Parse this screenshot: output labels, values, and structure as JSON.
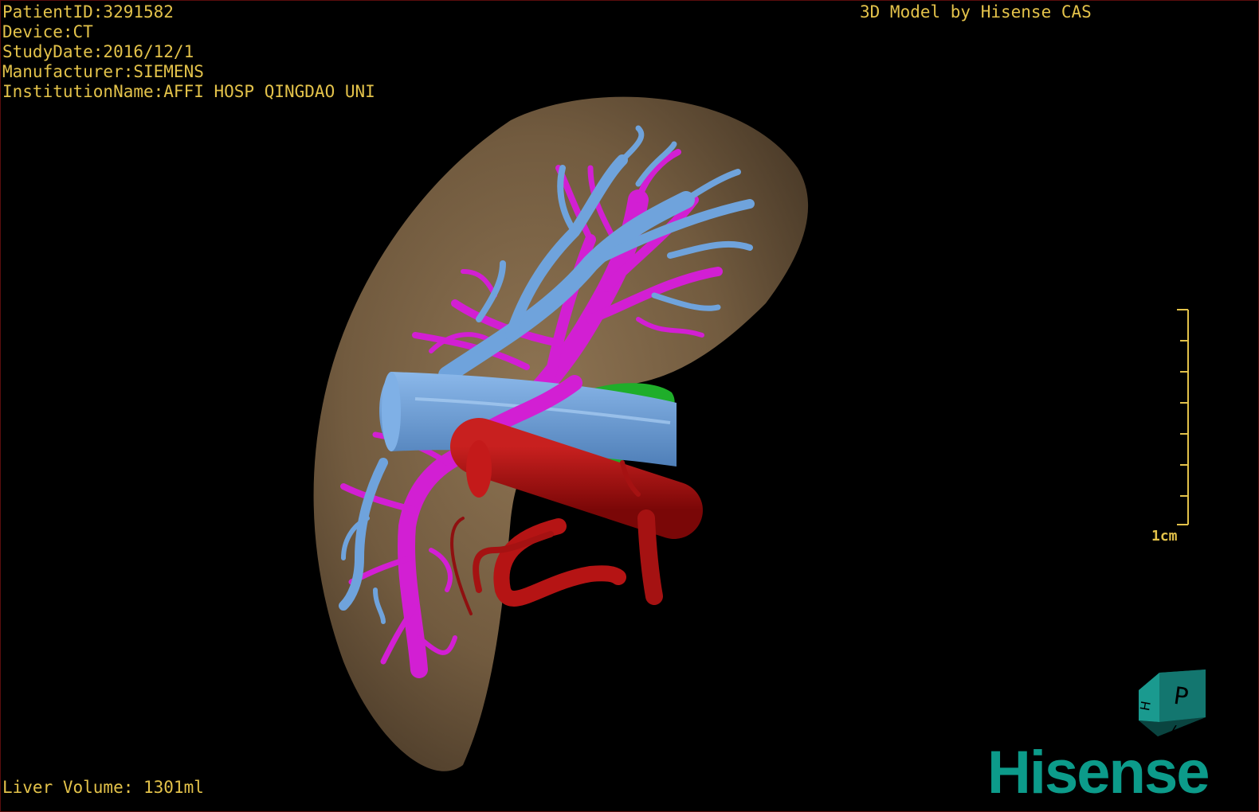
{
  "viewer": {
    "patient_id": "PatientID:3291582",
    "device": "Device:CT",
    "study_date": "StudyDate:2016/12/1",
    "manufacturer": "Manufacturer:SIEMENS",
    "institution": "InstitutionName:AFFI HOSP QINGDAO UNI",
    "credit": "3D Model by Hisense CAS",
    "liver_volume": "Liver Volume: 1301ml",
    "scale_label": "1cm",
    "logo_text": "Hisense",
    "orientation_cube": {
      "front_label": "P",
      "side_label": "H",
      "bottom_label": "7"
    }
  },
  "colors": {
    "liver": "#7a6244",
    "hepatic_vein": "#6fa3dc",
    "portal_vein": "#d21fd3",
    "ivc": "#b00f10",
    "gallbladder": "#1fae2a",
    "overlay_text": "#e3c24a",
    "brand": "#0c9b8a"
  }
}
